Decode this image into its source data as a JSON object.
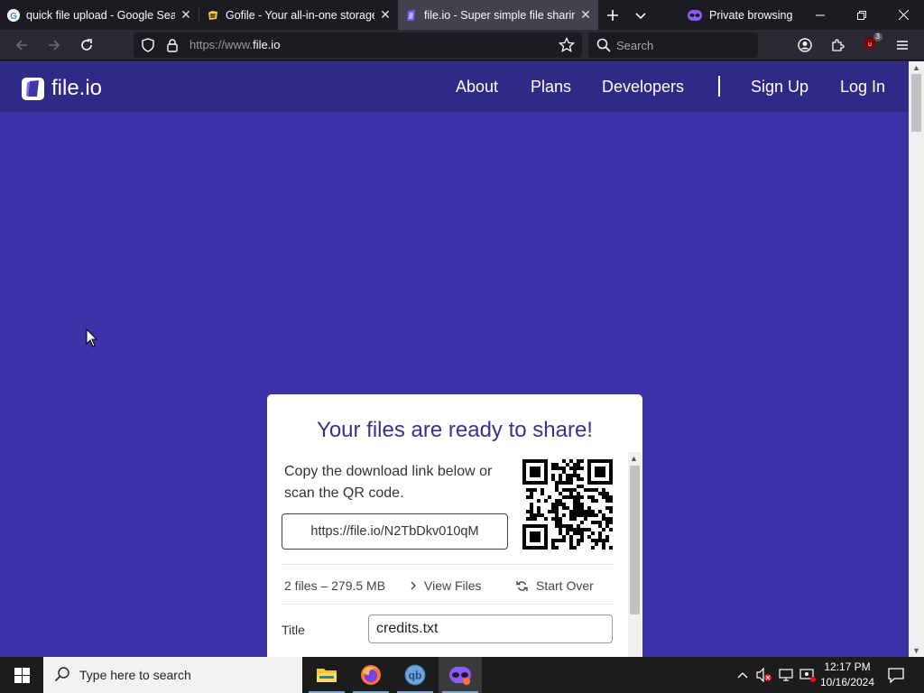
{
  "browser": {
    "tabs": [
      {
        "title": "quick file upload - Google Search",
        "favicon": "google-icon",
        "active": false
      },
      {
        "title": "Gofile - Your all-in-one storage solution",
        "favicon": "gofile-icon",
        "active": false
      },
      {
        "title": "file.io - Super simple file sharing",
        "favicon": "fileio-icon",
        "active": true
      }
    ],
    "private_label": "Private browsing",
    "url_prefix": "https://www.",
    "url_domain": "file.io",
    "search_placeholder": "Search",
    "extension_badge": "3"
  },
  "site": {
    "logo_text": "file.io",
    "nav": {
      "about": "About",
      "plans": "Plans",
      "developers": "Developers",
      "signup": "Sign Up",
      "login": "Log In"
    },
    "card": {
      "title": "Your files are ready to share!",
      "description": "Copy the download link below or scan the QR code.",
      "link": "https://file.io/N2TbDkv010qM",
      "summary": "2 files – 279.5 MB",
      "view_files": "View Files",
      "start_over": "Start Over",
      "title_label": "Title",
      "title_value": "credits.txt"
    },
    "colors": {
      "page_bg": "#3c32a8",
      "header_bg": "#2e2a85",
      "accent_text": "#38328f"
    }
  },
  "taskbar": {
    "search_placeholder": "Type here to search",
    "time": "12:17 PM",
    "date": "10/16/2024"
  }
}
